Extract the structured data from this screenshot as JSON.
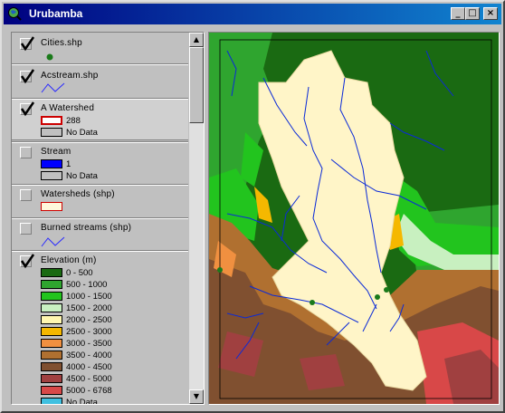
{
  "window": {
    "title": "Urubamba",
    "minimize": "_",
    "maximize": "□",
    "close": "×"
  },
  "layers": [
    {
      "name": "Cities.shp",
      "checked": true,
      "symbol": "point",
      "symbol_color": "#1a7a1a"
    },
    {
      "name": "Acstream.shp",
      "checked": true,
      "symbol": "line",
      "symbol_color": "#2a2aff"
    },
    {
      "name": "A Watershed",
      "checked": true,
      "active": true,
      "legend": [
        {
          "label": "288",
          "fill": "#ffffff",
          "outline": "#cc0000"
        },
        {
          "label": "No Data",
          "fill": "#c0c0c0",
          "outline": "#000000"
        }
      ]
    },
    {
      "name": "Stream",
      "checked": false,
      "legend": [
        {
          "label": "1",
          "fill": "#0000ff",
          "outline": "#000000"
        },
        {
          "label": "No Data",
          "fill": "#c0c0c0",
          "outline": "#000000"
        }
      ]
    },
    {
      "name": "Watersheds (shp)",
      "checked": false,
      "symbol": "polygon",
      "symbol_color": "#fff8dc",
      "outline": "#cc0000"
    },
    {
      "name": "Burned streams (shp)",
      "checked": false,
      "symbol": "line",
      "symbol_color": "#2a2aff"
    },
    {
      "name": "Elevation (m)",
      "checked": true,
      "legend": [
        {
          "label": "0 - 500",
          "fill": "#1a6a12"
        },
        {
          "label": "500 - 1000",
          "fill": "#2fa52f"
        },
        {
          "label": "1000 - 1500",
          "fill": "#22c41e"
        },
        {
          "label": "1500 - 2000",
          "fill": "#c8f0c0"
        },
        {
          "label": "2000 - 2500",
          "fill": "#fff7b0"
        },
        {
          "label": "2500 - 3000",
          "fill": "#f5b800"
        },
        {
          "label": "3000 - 3500",
          "fill": "#f09040"
        },
        {
          "label": "3500 - 4000",
          "fill": "#b07030"
        },
        {
          "label": "4000 - 4500",
          "fill": "#805030"
        },
        {
          "label": "4500 - 5000",
          "fill": "#a04040"
        },
        {
          "label": "5000 - 6768",
          "fill": "#d84848"
        },
        {
          "label": "No Data",
          "fill": "#40c0e0"
        }
      ]
    }
  ],
  "scrollbar": {
    "up": "▲",
    "down": "▼"
  },
  "colors": {
    "titlebar_start": "#000080",
    "titlebar_end": "#1084d0",
    "stream": "#0a2ad8",
    "watershed": "#fff5c8",
    "city": "#1a7a1a",
    "lowland": "#1a6a12",
    "mid1": "#2fa52f",
    "mid2": "#22c41e",
    "pale": "#c8f0c0",
    "highland": "#805030",
    "alpine": "#d84848"
  }
}
